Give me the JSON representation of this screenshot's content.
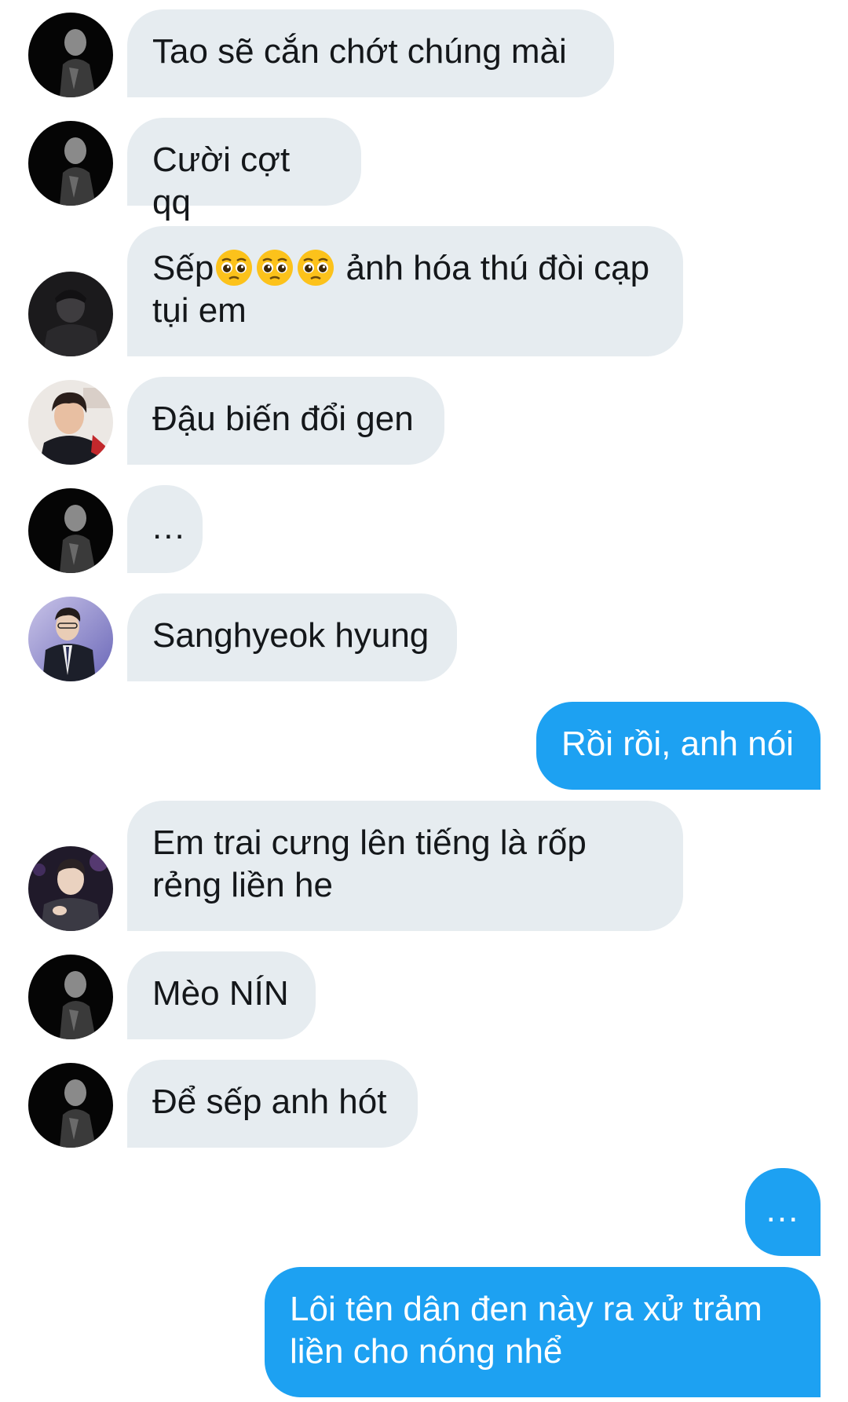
{
  "messages": [
    {
      "from": "incoming",
      "avatar": "dark-portrait-avatar",
      "text": "Tao sẽ cắn chớt chúng mài"
    },
    {
      "from": "incoming",
      "avatar": "dark-portrait-avatar",
      "text": "Cười cợt qq"
    },
    {
      "from": "incoming",
      "avatar": "dim-portrait-avatar",
      "text_before": "Sếp",
      "emoji": "pleading-face-emoji",
      "emoji_count": 3,
      "text_after": " ảnh hóa thú đòi cạp tụi em"
    },
    {
      "from": "incoming",
      "avatar": "light-portrait-avatar",
      "text": "Đậu biến đổi gen"
    },
    {
      "from": "incoming",
      "avatar": "dark-portrait-avatar",
      "text": "..."
    },
    {
      "from": "incoming",
      "avatar": "suit-portrait-avatar",
      "text": "Sanghyeok hyung"
    },
    {
      "from": "outgoing",
      "text": "Rồi rồi, anh nói"
    },
    {
      "from": "incoming",
      "avatar": "stage-portrait-avatar",
      "text": "Em trai cưng lên tiếng là rốp rẻng liền he"
    },
    {
      "from": "incoming",
      "avatar": "dark-portrait-avatar",
      "text": "Mèo NÍN"
    },
    {
      "from": "incoming",
      "avatar": "dark-portrait-avatar",
      "text": "Để sếp anh hót"
    },
    {
      "from": "outgoing",
      "text": "..."
    },
    {
      "from": "outgoing",
      "text": "Lôi tên dân đen này ra xử trảm liền cho nóng nhể"
    }
  ],
  "colors": {
    "incoming_bubble": "#e6ecf0",
    "incoming_text": "#14171a",
    "outgoing_bubble": "#1da1f2",
    "outgoing_text": "#ffffff",
    "background": "#ffffff"
  }
}
